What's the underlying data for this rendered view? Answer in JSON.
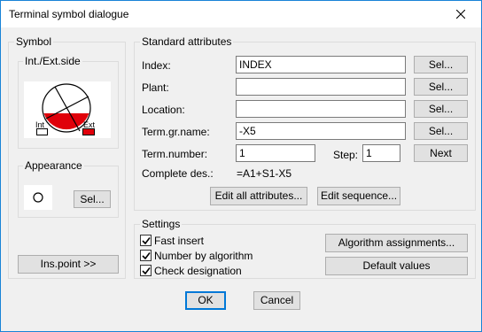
{
  "window": {
    "title": "Terminal symbol dialogue"
  },
  "symbol": {
    "group_label": "Symbol",
    "side_group_label": "Int./Ext.side",
    "int_label": "Int",
    "ext_label": "Ext",
    "appearance_label": "Appearance",
    "appearance_sel_button": "Sel...",
    "ins_point_button": "Ins.point >>"
  },
  "standard": {
    "group_label": "Standard attributes",
    "index_label": "Index:",
    "index_value": "INDEX",
    "plant_label": "Plant:",
    "plant_value": "",
    "location_label": "Location:",
    "location_value": "",
    "term_gr_name_label": "Term.gr.name:",
    "term_gr_name_value": "-X5",
    "term_number_label": "Term.number:",
    "term_number_value": "1",
    "step_label": "Step:",
    "step_value": "1",
    "next_button": "Next",
    "sel_button": "Sel...",
    "complete_des_label": "Complete des.:",
    "complete_des_value": "=A1+S1-X5",
    "edit_all_button": "Edit all attributes...",
    "edit_sequence_button": "Edit sequence..."
  },
  "settings": {
    "group_label": "Settings",
    "fast_insert_label": "Fast insert",
    "fast_insert_checked": true,
    "number_by_algorithm_label": "Number by algorithm",
    "number_by_algorithm_checked": true,
    "check_designation_label": "Check designation",
    "check_designation_checked": true,
    "algorithm_assignments_button": "Algorithm assignments...",
    "default_values_button": "Default values"
  },
  "footer": {
    "ok_button": "OK",
    "cancel_button": "Cancel"
  },
  "colors": {
    "accent": "#0078d7",
    "symbol_red": "#e0000a",
    "border_blue": "#1883d7"
  }
}
